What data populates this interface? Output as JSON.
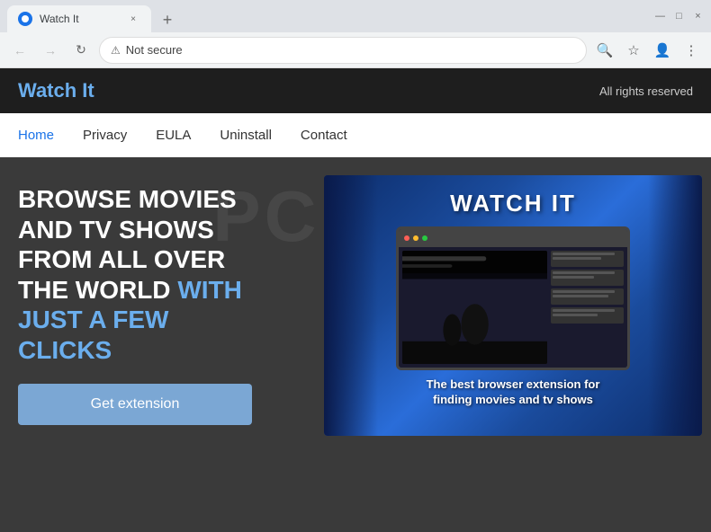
{
  "browser": {
    "tab": {
      "title": "Watch It",
      "close_label": "×"
    },
    "new_tab_label": "+",
    "window_controls": {
      "minimize": "—",
      "maximize": "□",
      "close": "×"
    },
    "address_bar": {
      "back_btn": "←",
      "forward_btn": "→",
      "reload_btn": "↻",
      "not_secure_label": "Not secure",
      "url": "",
      "search_icon": "🔍",
      "star_icon": "☆",
      "account_icon": "👤",
      "menu_icon": "⋮"
    }
  },
  "website": {
    "header": {
      "logo": "Watch It",
      "tagline": "All rights reserved"
    },
    "nav": {
      "items": [
        {
          "label": "Home",
          "active": true
        },
        {
          "label": "Privacy",
          "active": false
        },
        {
          "label": "EULA",
          "active": false
        },
        {
          "label": "Uninstall",
          "active": false
        },
        {
          "label": "Contact",
          "active": false
        }
      ]
    },
    "hero": {
      "text_white_1": "BROWSE MOVIES",
      "text_white_2": "AND TV SHOWS",
      "text_white_3": "FROM ALL OVER",
      "text_white_4": "THE WORLD ",
      "text_blue": "WITH\nJUST A FEW\nCLICKS",
      "cta_button": "Get extension"
    },
    "promo": {
      "title": "WATCH IT",
      "subtitle": "The best browser extension for\nfinding movies and tv shows"
    }
  }
}
